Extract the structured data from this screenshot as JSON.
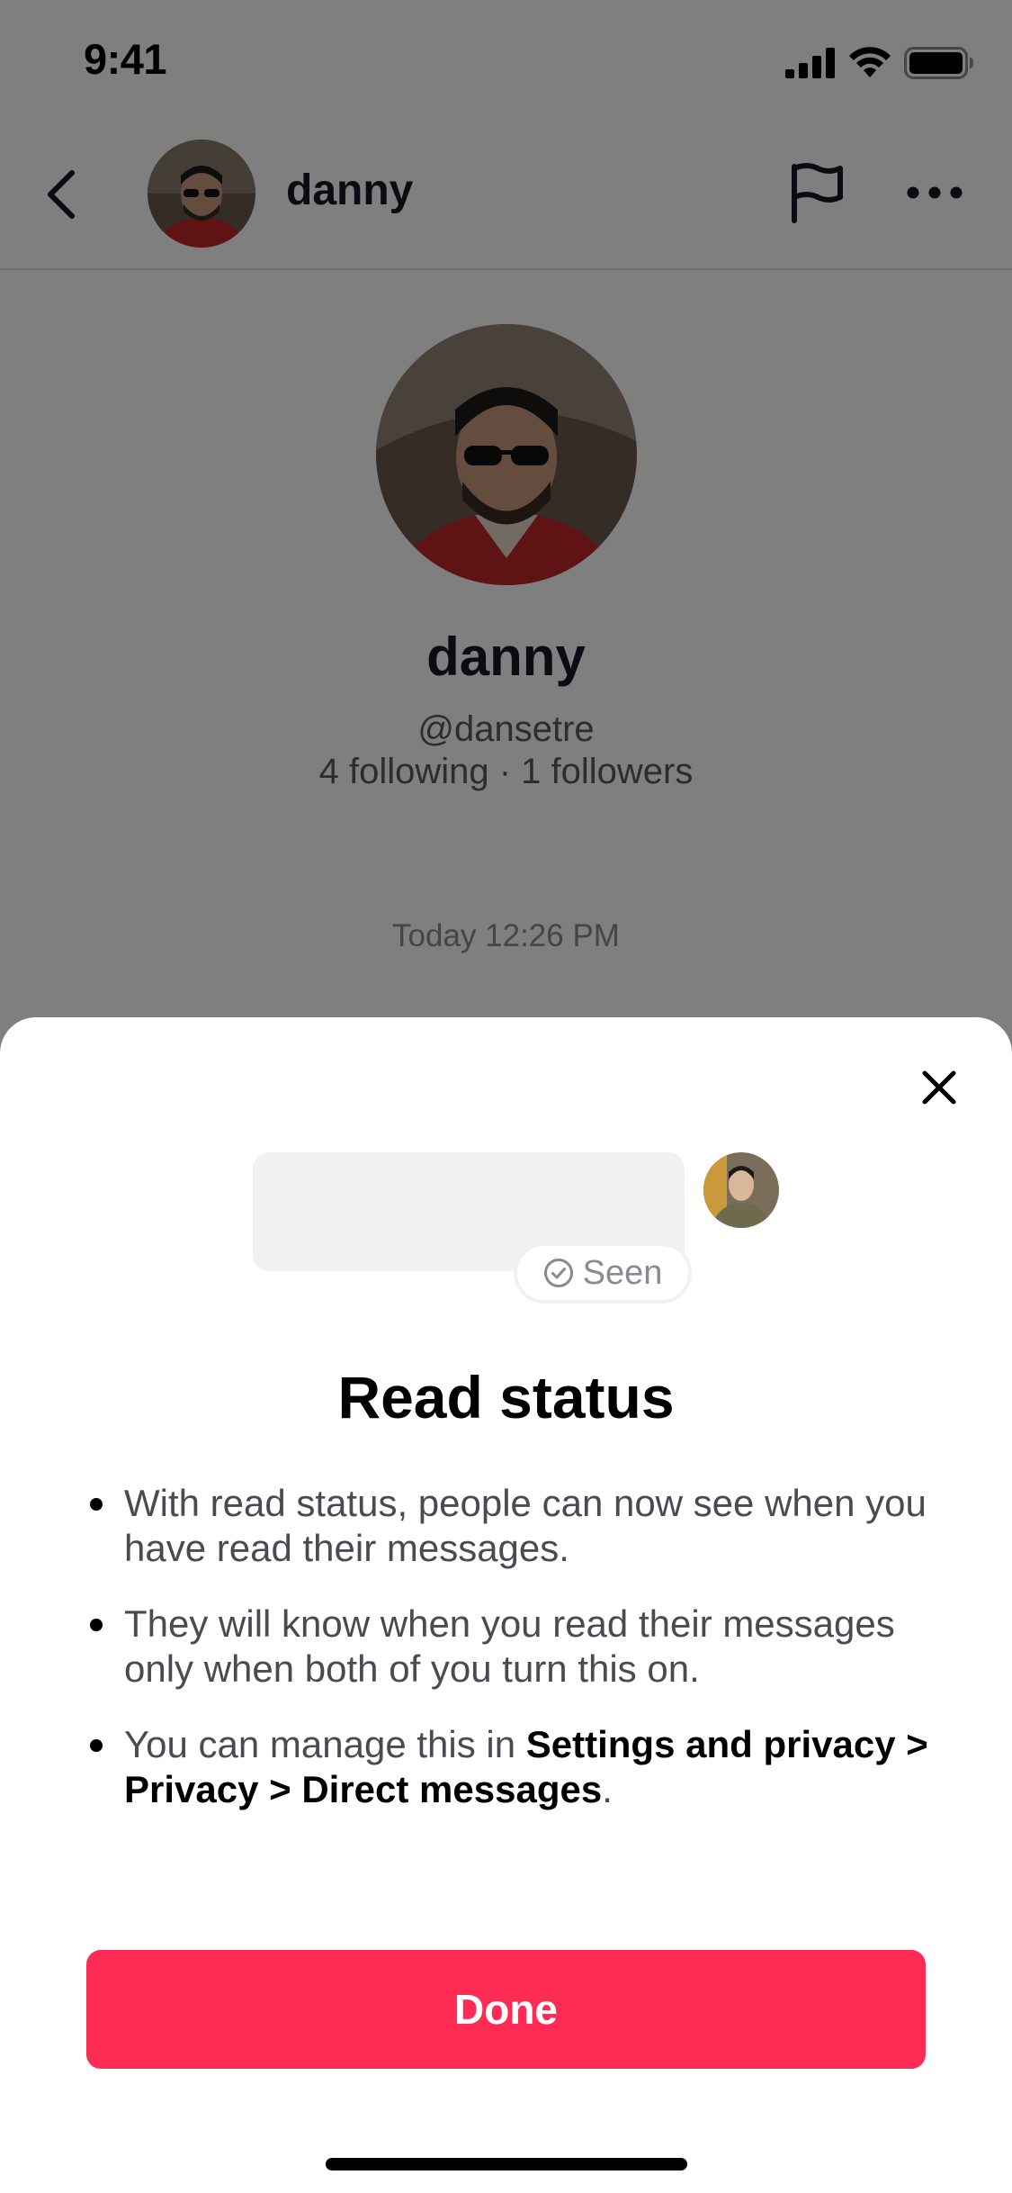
{
  "status_bar": {
    "time": "9:41",
    "icons": [
      "cellular-signal-icon",
      "wifi-icon",
      "battery-icon"
    ]
  },
  "header": {
    "name": "danny",
    "icons": [
      "back-chevron-icon",
      "flag-icon",
      "more-dots-icon"
    ]
  },
  "profile": {
    "name": "danny",
    "handle": "@dansetre",
    "stats": "4 following · 1 followers"
  },
  "chat": {
    "timestamp": "Today 12:26 PM"
  },
  "sheet": {
    "seen_label": "Seen",
    "title": "Read status",
    "bullets": {
      "b1": "With read status, people can now see when you have read their messages.",
      "b2": "They will know when you read their messages only when both of you turn this on.",
      "b3_prefix": "You can manage this in ",
      "b3_bold": "Settings and privacy > Privacy > Direct messages",
      "b3_suffix": "."
    },
    "done_label": "Done"
  },
  "colors": {
    "accent": "#fe2c55",
    "overlay": "rgba(0,0,0,0.5)",
    "bubble": "#f1f1f2"
  }
}
